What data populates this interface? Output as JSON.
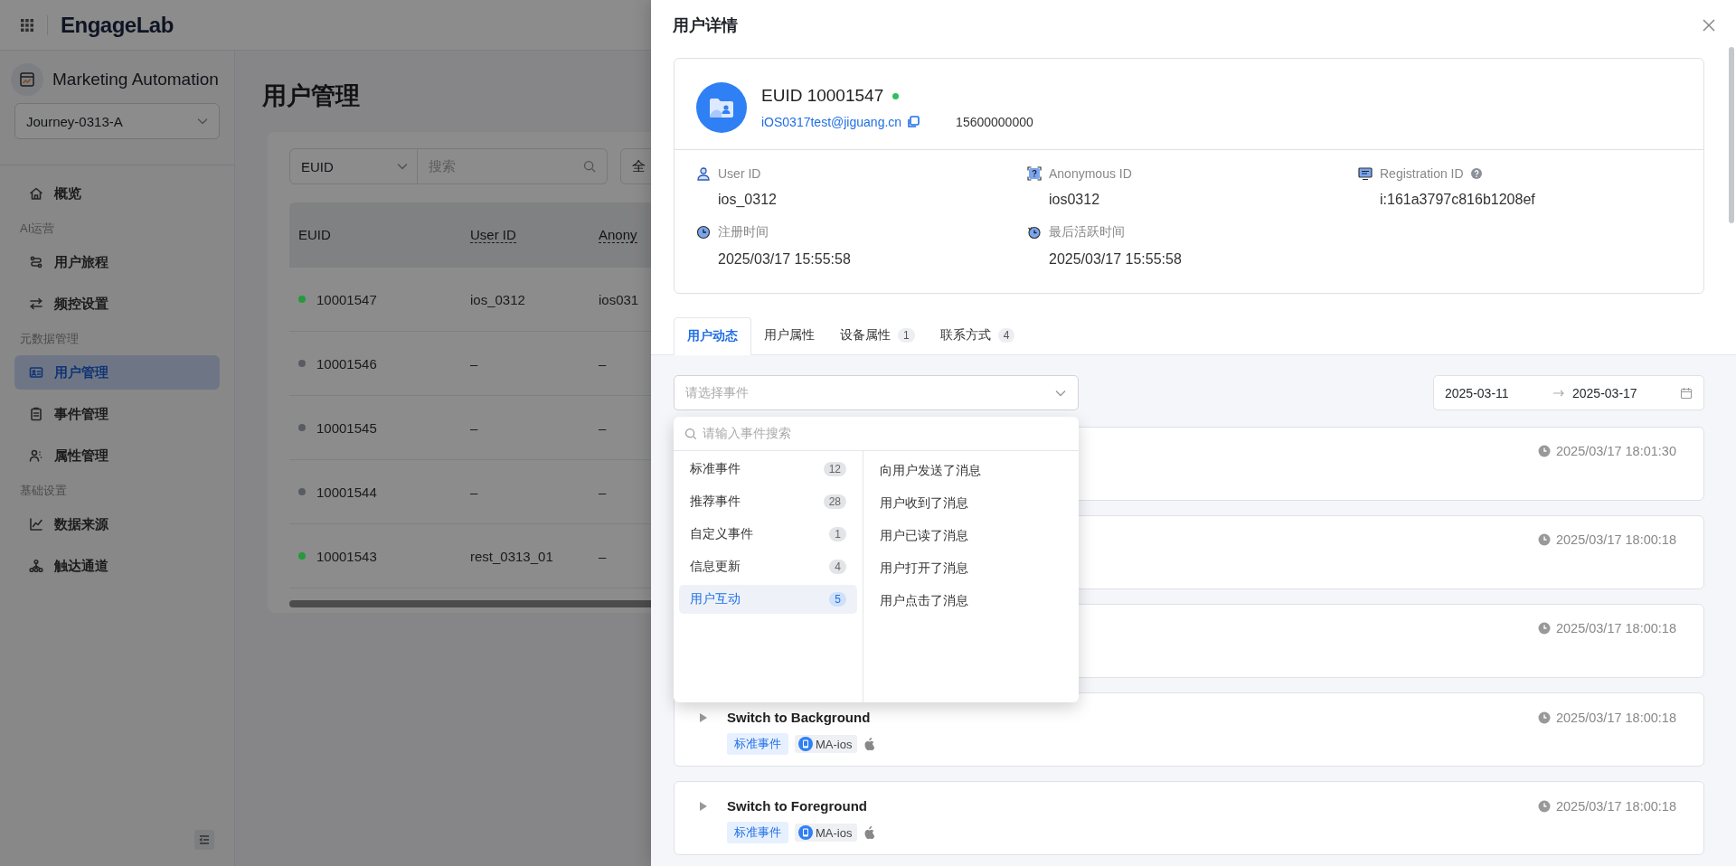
{
  "topbar": {
    "logo": "EngageLab"
  },
  "sidebar": {
    "app_title": "Marketing Automation",
    "journey_select": "Journey-0313-A",
    "nav": [
      {
        "kind": "item",
        "label": "概览",
        "selected": false
      },
      {
        "kind": "group",
        "label": "AI运营"
      },
      {
        "kind": "item",
        "label": "用户旅程",
        "selected": false
      },
      {
        "kind": "item",
        "label": "频控设置",
        "selected": false
      },
      {
        "kind": "group",
        "label": "元数据管理"
      },
      {
        "kind": "item",
        "label": "用户管理",
        "selected": true
      },
      {
        "kind": "item",
        "label": "事件管理",
        "selected": false
      },
      {
        "kind": "item",
        "label": "属性管理",
        "selected": false
      },
      {
        "kind": "group",
        "label": "基础设置"
      },
      {
        "kind": "item",
        "label": "数据来源",
        "selected": false
      },
      {
        "kind": "item",
        "label": "触达通道",
        "selected": false
      }
    ]
  },
  "main": {
    "title": "用户管理",
    "filter": {
      "field": "EUID",
      "search_placeholder": "搜索",
      "scope": "全"
    },
    "table": {
      "columns": [
        "EUID",
        "User ID",
        "Anony"
      ],
      "rows": [
        {
          "color": "#239a3c",
          "cells": [
            "10001547",
            "ios_0312",
            "ios031"
          ]
        },
        {
          "color": "#585c62",
          "cells": [
            "10001546",
            "–",
            "–"
          ]
        },
        {
          "color": "#585c62",
          "cells": [
            "10001545",
            "–",
            "–"
          ]
        },
        {
          "color": "#585c62",
          "cells": [
            "10001544",
            "–",
            "–"
          ]
        },
        {
          "color": "#239a3c",
          "cells": [
            "10001543",
            "rest_0313_01",
            "–"
          ]
        }
      ]
    }
  },
  "drawer": {
    "title": "用户详情",
    "profile": {
      "euid": "EUID 10001547",
      "online": true,
      "email": "iOS0317test@jiguang.cn",
      "phone": "15600000000",
      "fields": [
        {
          "label": "User ID",
          "value": "ios_0312",
          "help": false
        },
        {
          "label": "Anonymous ID",
          "value": "ios0312",
          "help": false
        },
        {
          "label": "Registration ID",
          "value": "i:161a3797c816b1208ef",
          "help": true
        },
        {
          "label": "注册时间",
          "value": "2025/03/17 15:55:58",
          "help": false
        },
        {
          "label": "最后活跃时间",
          "value": "2025/03/17 15:55:58",
          "help": false
        }
      ]
    },
    "tabs": [
      {
        "label": "用户动态",
        "selected": true
      },
      {
        "label": "用户属性",
        "selected": false
      },
      {
        "label": "设备属性",
        "count": "1",
        "selected": false
      },
      {
        "label": "联系方式",
        "count": "4",
        "selected": false
      }
    ],
    "event_select": {
      "placeholder": "请选择事件"
    },
    "date_range": {
      "start": "2025-03-11",
      "end": "2025-03-17"
    },
    "event_dropdown": {
      "search_placeholder": "请输入事件搜索",
      "categories": [
        {
          "label": "标准事件",
          "count": "12",
          "selected": false
        },
        {
          "label": "推荐事件",
          "count": "28",
          "selected": false
        },
        {
          "label": "自定义事件",
          "count": "1",
          "selected": false
        },
        {
          "label": "信息更新",
          "count": "4",
          "selected": false
        },
        {
          "label": "用户互动",
          "count": "5",
          "selected": true
        }
      ],
      "events": [
        "向用户发送了消息",
        "用户收到了消息",
        "用户已读了消息",
        "用户打开了消息",
        "用户点击了消息"
      ]
    },
    "events": [
      {
        "time": "2025/03/17 18:01:30"
      },
      {
        "time": "2025/03/17 18:00:18"
      },
      {
        "time": "2025/03/17 18:00:18"
      },
      {
        "title": "Switch to Background",
        "tag": "标准事件",
        "app": "MA-ios",
        "time": "2025/03/17 18:00:18"
      },
      {
        "title": "Switch to Foreground",
        "tag": "标准事件",
        "app": "MA-ios",
        "time": "2025/03/17 18:00:18"
      }
    ]
  }
}
